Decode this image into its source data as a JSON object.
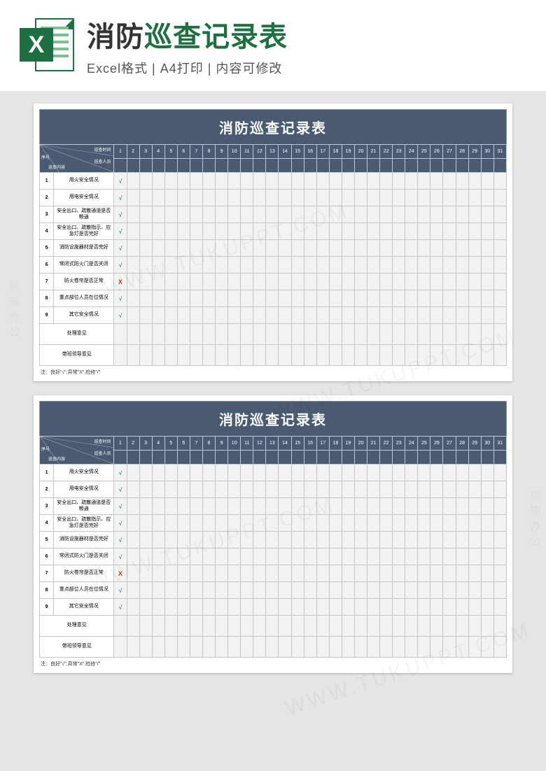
{
  "banner": {
    "title_plain": "消防",
    "title_accent": "巡查记录表",
    "subtitle": "Excel格式 | A4打印 | 内容可修改"
  },
  "excel_icon_letter": "X",
  "sheet": {
    "title": "消防巡查记录表",
    "corner": {
      "seq": "序号",
      "time": "巡查时间",
      "person": "巡查人员",
      "content": "巡查内容"
    },
    "days": [
      "1",
      "2",
      "3",
      "4",
      "5",
      "6",
      "7",
      "8",
      "9",
      "10",
      "11",
      "12",
      "13",
      "14",
      "15",
      "16",
      "17",
      "18",
      "19",
      "20",
      "21",
      "22",
      "23",
      "24",
      "25",
      "26",
      "27",
      "28",
      "29",
      "30",
      "31"
    ],
    "rows": [
      {
        "seq": "1",
        "item": "用火安全情况",
        "mark": "√",
        "mark_type": "ok"
      },
      {
        "seq": "2",
        "item": "用电安全情况",
        "mark": "√",
        "mark_type": "ok"
      },
      {
        "seq": "3",
        "item": "安全出口、疏散通道是否畅通",
        "mark": "√",
        "mark_type": "ok"
      },
      {
        "seq": "4",
        "item": "安全出口、疏散指示、应急灯是否完好",
        "mark": "√",
        "mark_type": "ok"
      },
      {
        "seq": "5",
        "item": "消防设施器材是否完好",
        "mark": "√",
        "mark_type": "ok"
      },
      {
        "seq": "6",
        "item": "常闭式防火门是否关闭",
        "mark": "√",
        "mark_type": "ok"
      },
      {
        "seq": "7",
        "item": "防火卷帘是否正常",
        "mark": "X",
        "mark_type": "bad"
      },
      {
        "seq": "8",
        "item": "重点部位人员在位情况",
        "mark": "√",
        "mark_type": "ok"
      },
      {
        "seq": "9",
        "item": "其它安全情况",
        "mark": "√",
        "mark_type": "ok"
      },
      {
        "seq": "",
        "item": "处理意见",
        "mark": "",
        "mark_type": ""
      },
      {
        "seq": "",
        "item": "带班领导意见",
        "mark": "",
        "mark_type": ""
      }
    ],
    "footnote": "注：良好\"√\",异常\"X\",检修\"/\""
  },
  "watermark": "WWW.TUKUPPT.COM",
  "side_watermark": "熊猫办公"
}
